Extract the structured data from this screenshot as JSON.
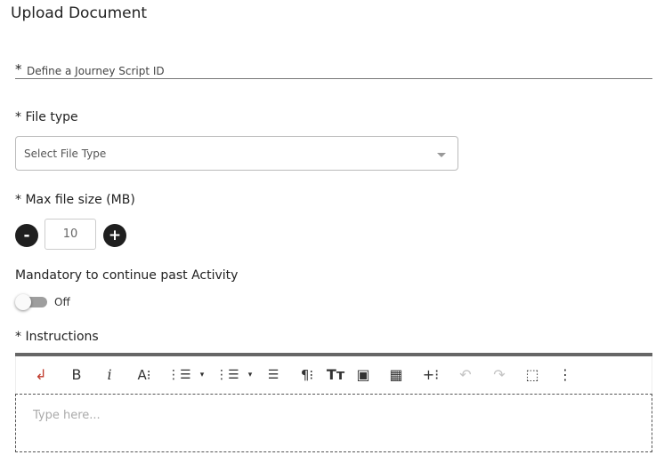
{
  "header": {
    "title": "Upload Document"
  },
  "journey_id": {
    "star": "*",
    "placeholder": "Define a Journey Script ID"
  },
  "file_type": {
    "label": "* File type",
    "selected": "Select File Type"
  },
  "max_size": {
    "label": "* Max file size (MB)",
    "value": "10",
    "minus": "-",
    "plus": "+"
  },
  "mandatory": {
    "label": "Mandatory to continue past Activity",
    "toggle_state": "Off"
  },
  "instructions": {
    "label": "* Instructions",
    "placeholder": "Type here..."
  },
  "toolbar": {
    "enter": "↲",
    "bold": "B",
    "italic": "i",
    "font_size": "A⁝",
    "ordered": "⋮☰",
    "caret": "▾",
    "bullet": "⋮☰",
    "align": "☰",
    "paragraph": "¶⁝",
    "text_style": "Tт",
    "image": "▣",
    "table": "▦",
    "insert": "+⁝",
    "undo": "↶",
    "redo": "↷",
    "select_all": "⬚",
    "more": "⋮"
  }
}
